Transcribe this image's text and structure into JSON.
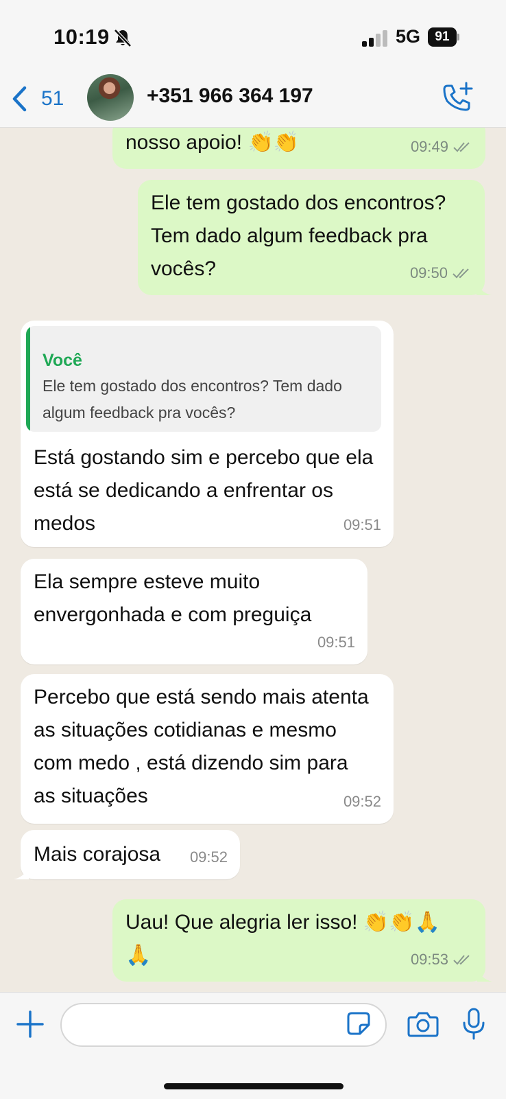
{
  "status_bar": {
    "time": "10:19",
    "network": "5G",
    "battery": "91"
  },
  "header": {
    "back_count": "51",
    "contact_name": "+351 966 364 197"
  },
  "messages": [
    {
      "id": 0,
      "direction": "out",
      "text": "nosso apoio! 👏👏",
      "time": "09:49",
      "status": "read"
    },
    {
      "id": 1,
      "direction": "out",
      "text": "Ele tem gostado dos encontros? Tem dado algum feedback pra vocês?",
      "time": "09:50",
      "status": "read"
    },
    {
      "id": 2,
      "direction": "in",
      "quote": {
        "author": "Você",
        "text": "Ele tem gostado dos encontros? Tem dado algum feedback pra vocês?"
      },
      "text": "Está gostando sim e percebo que ela está se dedicando a enfrentar os medos",
      "time": "09:51"
    },
    {
      "id": 3,
      "direction": "in",
      "text": "Ela sempre esteve muito envergonhada e com preguiça",
      "time": "09:51"
    },
    {
      "id": 4,
      "direction": "in",
      "text": "Percebo que está sendo mais atenta as situações cotidianas e mesmo com medo , está dizendo sim para as situações",
      "time": "09:52"
    },
    {
      "id": 5,
      "direction": "in",
      "text": "Mais corajosa",
      "time": "09:52"
    },
    {
      "id": 6,
      "direction": "out",
      "text": "Uau! Que alegria ler isso! 👏👏🙏🙏",
      "time": "09:53",
      "status": "read"
    }
  ],
  "input": {
    "placeholder": ""
  },
  "colors": {
    "accent": "#1a73c8",
    "outgoing_bubble": "#dcf8c6",
    "incoming_bubble": "#ffffff",
    "chat_background": "#efeae2",
    "quote_bar": "#1fa855"
  },
  "icons": [
    "bell-muted-icon",
    "signal-icon",
    "battery-icon",
    "chevron-left-icon",
    "add-call-icon",
    "read-ticks-icon",
    "plus-icon",
    "sticker-icon",
    "camera-icon",
    "mic-icon"
  ]
}
